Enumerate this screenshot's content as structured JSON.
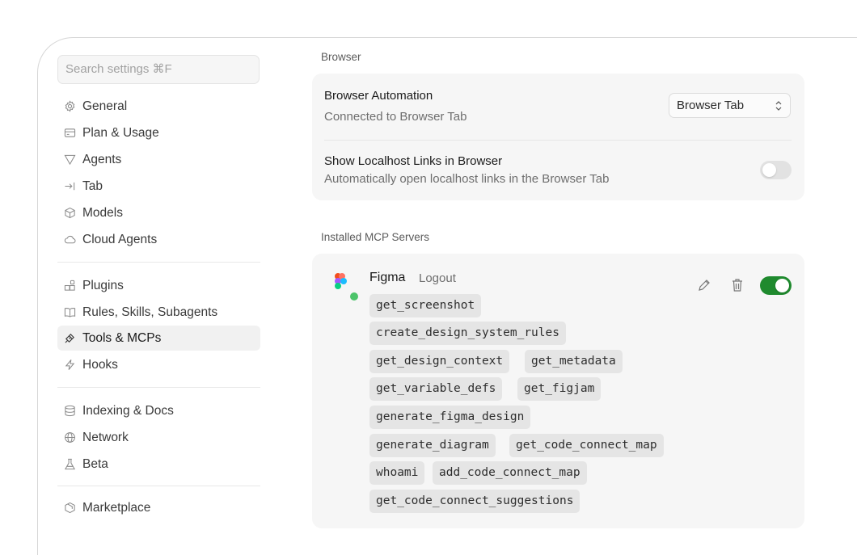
{
  "sidebar": {
    "search_placeholder": "Search settings ⌘F",
    "groups": [
      [
        {
          "label": "General",
          "icon": "gear-icon"
        },
        {
          "label": "Plan & Usage",
          "icon": "card-icon"
        },
        {
          "label": "Agents",
          "icon": "funnel-icon"
        },
        {
          "label": "Tab",
          "icon": "tab-arrow-icon"
        },
        {
          "label": "Models",
          "icon": "cube-icon"
        },
        {
          "label": "Cloud Agents",
          "icon": "cloud-icon"
        }
      ],
      [
        {
          "label": "Plugins",
          "icon": "plugin-icon"
        },
        {
          "label": "Rules, Skills, Subagents",
          "icon": "book-icon"
        },
        {
          "label": "Tools & MCPs",
          "icon": "tools-icon",
          "active": true
        },
        {
          "label": "Hooks",
          "icon": "bolt-icon"
        }
      ],
      [
        {
          "label": "Indexing & Docs",
          "icon": "database-icon"
        },
        {
          "label": "Network",
          "icon": "globe-icon"
        },
        {
          "label": "Beta",
          "icon": "flask-icon"
        }
      ],
      [
        {
          "label": "Marketplace",
          "icon": "marketplace-icon"
        }
      ]
    ]
  },
  "browser": {
    "section_label": "Browser",
    "automation_title": "Browser Automation",
    "automation_status": "Connected to Browser Tab",
    "select_value": "Browser Tab",
    "localhost_title": "Show Localhost Links in Browser",
    "localhost_desc": "Automatically open localhost links in the Browser Tab",
    "localhost_enabled": false
  },
  "mcp": {
    "section_label": "Installed MCP Servers",
    "server_name": "Figma",
    "logout_label": "Logout",
    "status_color": "#4cc46a",
    "enabled": true,
    "tools": [
      "get_screenshot",
      "create_design_system_rules",
      "get_design_context",
      "get_metadata",
      "get_variable_defs",
      "get_figjam",
      "generate_figma_design",
      "generate_diagram",
      "get_code_connect_map",
      "whoami",
      "add_code_connect_map",
      "get_code_connect_suggestions"
    ]
  },
  "colors": {
    "toggle_on": "#1f8a2e",
    "toggle_off": "#e2e2e2",
    "card_bg": "#f6f6f6"
  }
}
